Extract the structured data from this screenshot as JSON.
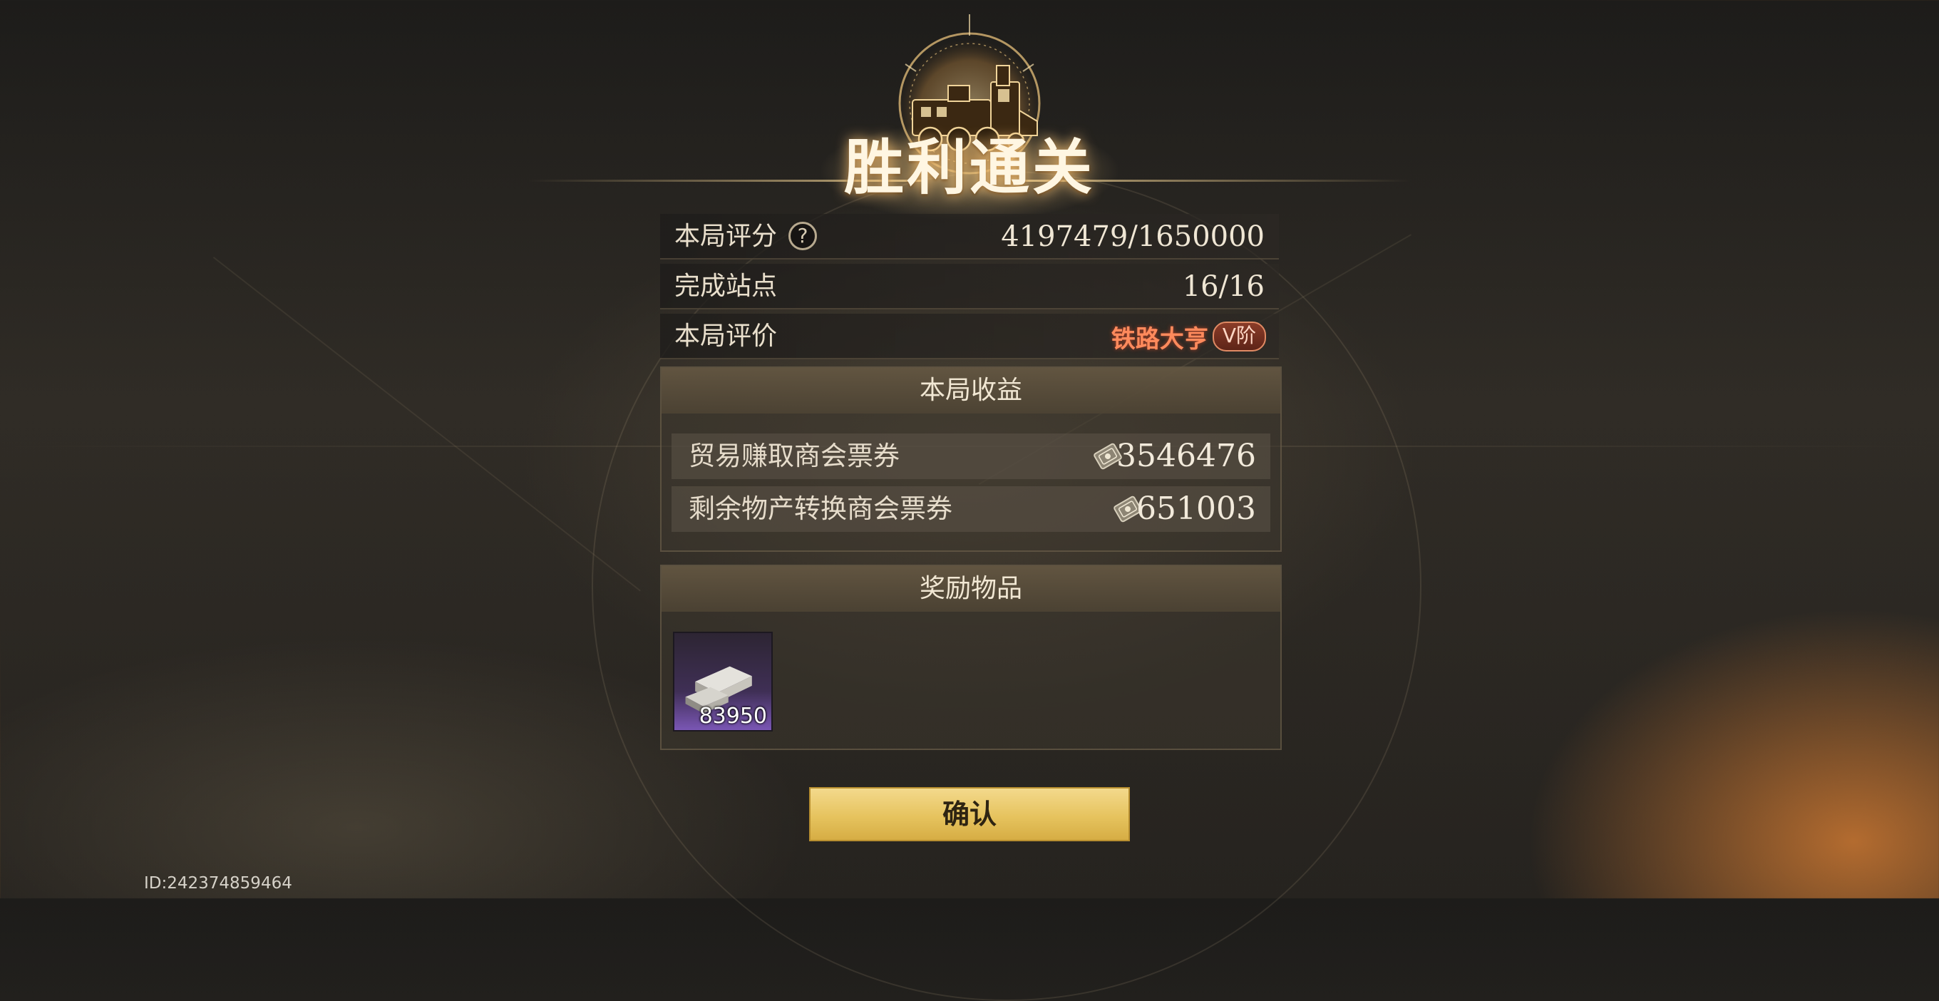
{
  "result": {
    "title": "胜利通关"
  },
  "stats": {
    "score_label": "本局评分",
    "score_help": "?",
    "score_value": "4197479/1650000",
    "stations_label": "完成站点",
    "stations_value": "16/16",
    "rating_label": "本局评价",
    "rating_name": "铁路大亨",
    "rating_tier": "V阶"
  },
  "earnings": {
    "header": "本局收益",
    "items": [
      {
        "label": "贸易赚取商会票券",
        "icon": "ticket-icon",
        "value": "3546476"
      },
      {
        "label": "剩余物产转换商会票券",
        "icon": "ticket-icon",
        "value": "651003"
      }
    ]
  },
  "rewards": {
    "header": "奖励物品",
    "items": [
      {
        "icon": "silver-ingot-icon",
        "count": "83950"
      }
    ]
  },
  "actions": {
    "confirm_label": "确认"
  },
  "footer": {
    "player_id": "ID:242374859464"
  },
  "colors": {
    "accent_gold": "#e6c35e",
    "rating_red": "#ff8a5c",
    "reward_purple": "#7a56b4"
  }
}
